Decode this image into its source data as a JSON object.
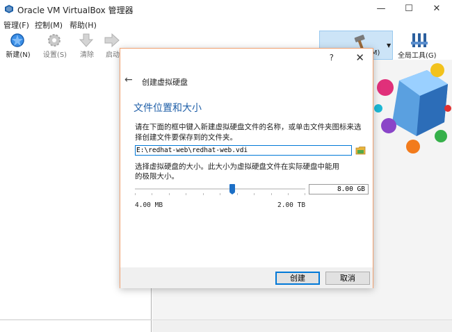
{
  "window": {
    "title": "Oracle VM VirtualBox 管理器",
    "minimize": "—",
    "maximize": "☐",
    "close": "✕"
  },
  "menu": [
    "管理(F)",
    "控制(M)",
    "帮助(H)"
  ],
  "toolbar": {
    "new_label": "新建(N)",
    "settings_label": "设置(S)",
    "discard_label": "清除",
    "start_label": "启动",
    "machine_tools_label": "(M)",
    "global_tools_label": "全局工具(G)"
  },
  "dialog": {
    "help": "?",
    "close": "✕",
    "back": "←",
    "heading": "创建虚拟硬盘",
    "section_title": "文件位置和大小",
    "location_desc": "请在下面的框中键入新建虚拟硬盘文件的名称，或单击文件夹图标来选择创建文件要保存到的文件夹。",
    "path_value": "E:\\redhat-web\\redhat-web.vdi",
    "size_desc": "选择虚拟硬盘的大小。此大小为虚拟硬盘文件在实际硬盘中能用的极限大小。",
    "size_value": "8.00 GB",
    "min_label": "4.00 MB",
    "max_label": "2.00 TB",
    "create_button": "创建",
    "cancel_button": "取消"
  },
  "colors": {
    "accent": "#0078d7",
    "section_title": "#1f5fa8",
    "dialog_border": "#f0a070",
    "selected_tool_bg": "#cce4f7"
  }
}
